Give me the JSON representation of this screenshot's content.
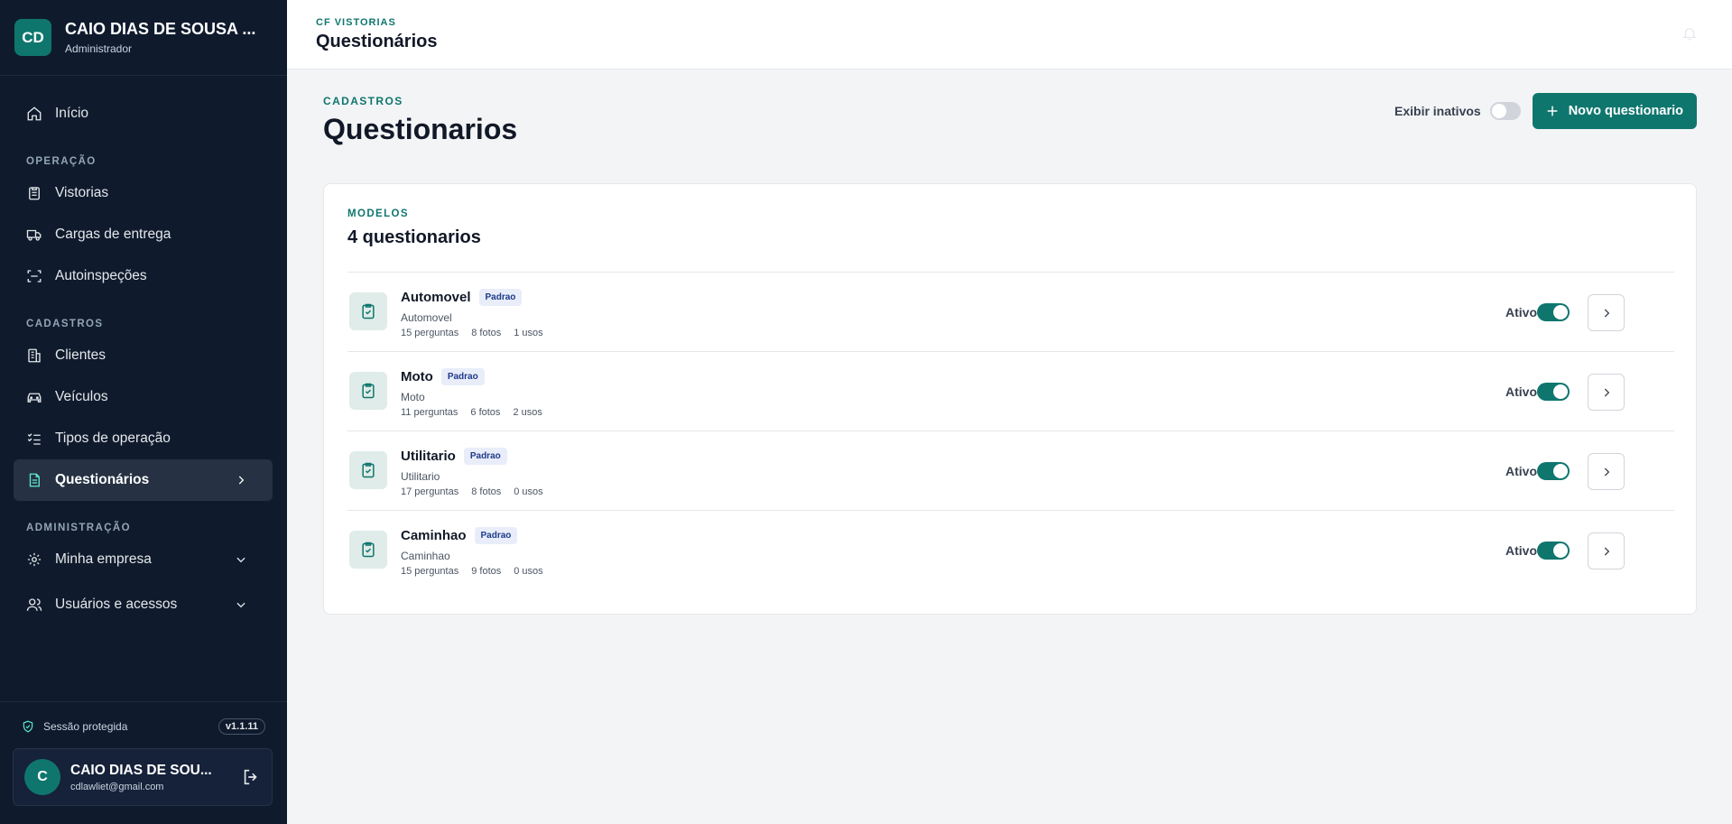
{
  "brand": {
    "initials": "CD",
    "name": "CAIO DIAS DE SOUSA ...",
    "role": "Administrador"
  },
  "nav": {
    "home": "Início",
    "section_operacao": "OPERAÇÃO",
    "vistorias": "Vistorias",
    "cargas": "Cargas de entrega",
    "autoinspecoes": "Autoinspeções",
    "section_cadastros": "CADASTROS",
    "clientes": "Clientes",
    "veiculos": "Veículos",
    "tipos": "Tipos de operação",
    "questionarios": "Questionários",
    "section_admin": "ADMINISTRAÇÃO",
    "empresa": "Minha empresa",
    "usuarios": "Usuários e acessos"
  },
  "footer": {
    "session": "Sessão protegida",
    "version": "v1.1.11",
    "user_initial": "C",
    "user_name": "CAIO DIAS DE SOU...",
    "user_email": "cdlawliet@gmail.com"
  },
  "topbar": {
    "kicker": "CF VISTORIAS",
    "title": "Questionários"
  },
  "page": {
    "kicker": "CADASTROS",
    "title": "Questionarios",
    "show_inactive_label": "Exibir inativos",
    "new_button": "Novo questionario"
  },
  "card": {
    "kicker": "MODELOS",
    "title": "4 questionarios",
    "rows": [
      {
        "name": "Automovel",
        "badge": "Padrao",
        "sub": "Automovel",
        "perguntas": "15 perguntas",
        "fotos": "8 fotos",
        "usos": "1 usos",
        "status": "Ativo"
      },
      {
        "name": "Moto",
        "badge": "Padrao",
        "sub": "Moto",
        "perguntas": "11 perguntas",
        "fotos": "6 fotos",
        "usos": "2 usos",
        "status": "Ativo"
      },
      {
        "name": "Utilitario",
        "badge": "Padrao",
        "sub": "Utilitario",
        "perguntas": "17 perguntas",
        "fotos": "8 fotos",
        "usos": "0 usos",
        "status": "Ativo"
      },
      {
        "name": "Caminhao",
        "badge": "Padrao",
        "sub": "Caminhao",
        "perguntas": "15 perguntas",
        "fotos": "9 fotos",
        "usos": "0 usos",
        "status": "Ativo"
      }
    ]
  },
  "colors": {
    "accent": "#0f766e",
    "sidebar": "#0f1b2d"
  }
}
